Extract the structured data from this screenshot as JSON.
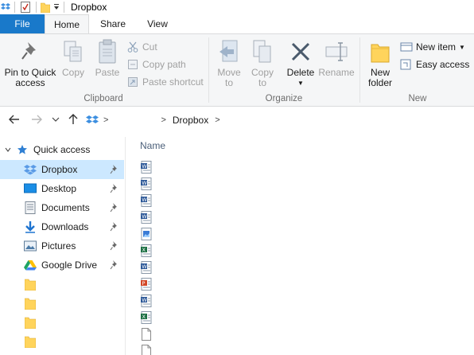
{
  "window": {
    "title": "Dropbox"
  },
  "tabs": {
    "file": "File",
    "home": "Home",
    "share": "Share",
    "view": "View"
  },
  "ribbon": {
    "clipboard": {
      "label": "Clipboard",
      "pin_line1": "Pin to Quick",
      "pin_line2": "access",
      "copy": "Copy",
      "paste": "Paste",
      "cut": "Cut",
      "copy_path": "Copy path",
      "paste_shortcut": "Paste shortcut"
    },
    "organize": {
      "label": "Organize",
      "move_to_line1": "Move",
      "move_to_line2": "to",
      "copy_to_line1": "Copy",
      "copy_to_line2": "to",
      "delete": "Delete",
      "rename": "Rename"
    },
    "new": {
      "label": "New",
      "new_folder_line1": "New",
      "new_folder_line2": "folder",
      "new_item": "New item",
      "easy_access": "Easy access"
    }
  },
  "address": {
    "crumbs": [
      "",
      "Dropbox"
    ]
  },
  "navpane": {
    "quick_access": "Quick access",
    "items": [
      {
        "label": "Dropbox",
        "icon": "dropbox-icon",
        "pinned": true,
        "selected": true
      },
      {
        "label": "Desktop",
        "icon": "desktop-icon",
        "pinned": true
      },
      {
        "label": "Documents",
        "icon": "documents-icon",
        "pinned": true
      },
      {
        "label": "Downloads",
        "icon": "downloads-icon",
        "pinned": true
      },
      {
        "label": "Pictures",
        "icon": "pictures-icon",
        "pinned": true
      },
      {
        "label": "Google Drive",
        "icon": "google-drive-icon",
        "pinned": true
      },
      {
        "label": "",
        "icon": "folder-icon"
      },
      {
        "label": "",
        "icon": "folder-icon"
      },
      {
        "label": "",
        "icon": "folder-icon"
      },
      {
        "label": "",
        "icon": "folder-icon"
      }
    ]
  },
  "filelist": {
    "column_name": "Name",
    "files": [
      {
        "name": "",
        "icon": "word-doc-icon"
      },
      {
        "name": "",
        "icon": "word-doc-icon"
      },
      {
        "name": "",
        "icon": "word-doc-icon"
      },
      {
        "name": "",
        "icon": "word-doc-icon"
      },
      {
        "name": "",
        "icon": "picture-file-icon"
      },
      {
        "name": "",
        "icon": "excel-file-icon"
      },
      {
        "name": "",
        "icon": "word-doc-icon"
      },
      {
        "name": "",
        "icon": "powerpoint-file-icon"
      },
      {
        "name": "",
        "icon": "word-doc-icon"
      },
      {
        "name": "",
        "icon": "excel-file-icon"
      },
      {
        "name": "",
        "icon": "blank-file-icon"
      },
      {
        "name": "",
        "icon": "blank-file-icon"
      }
    ]
  },
  "colors": {
    "accent": "#1979ca",
    "selected": "#cce8ff",
    "ribbon_bg": "#f5f6f7",
    "dropbox_blue": "#0061fe"
  }
}
